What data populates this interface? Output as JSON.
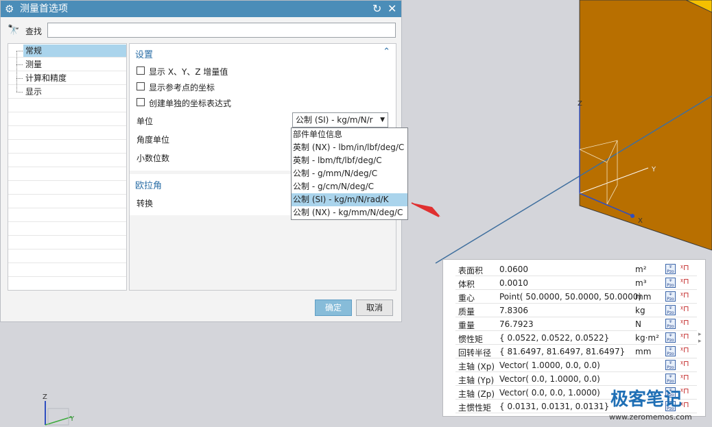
{
  "dialog": {
    "title": "测量首选项",
    "find_label": "查找",
    "find_value": "",
    "tree": [
      "常规",
      "测量",
      "计算和精度",
      "显示"
    ],
    "section1_title": "设置",
    "checkboxes": [
      "显示 X、Y、Z 增量值",
      "显示参考点的坐标",
      "创建单独的坐标表达式"
    ],
    "unit_label": "单位",
    "unit_value": "公制 (SI) - kg/m/N/r",
    "angle_unit_label": "角度单位",
    "decimals_label": "小数位数",
    "section2_title": "欧拉角",
    "convert_label": "转换",
    "ok_label": "确定",
    "cancel_label": "取消"
  },
  "dropdown": {
    "options": [
      "部件单位信息",
      "英制 (NX) - lbm/in/lbf/deg/C",
      "英制 - lbm/ft/lbf/deg/C",
      "公制 - g/mm/N/deg/C",
      "公制 - g/cm/N/deg/C",
      "公制 (SI) - kg/m/N/rad/K",
      "公制 (NX) - kg/mm/N/deg/C"
    ],
    "selected": "公制 (SI) - kg/m/N/rad/K"
  },
  "results": [
    {
      "name": "表面积",
      "value": "0.0600",
      "unit": "m²"
    },
    {
      "name": "体积",
      "value": "0.0010",
      "unit": "m³"
    },
    {
      "name": "重心",
      "value": "Point( 50.0000, 50.0000, 50.0000)",
      "unit": "mm"
    },
    {
      "name": "质量",
      "value": "7.8306",
      "unit": "kg"
    },
    {
      "name": "重量",
      "value": "76.7923",
      "unit": "N"
    },
    {
      "name": "惯性矩",
      "value": "{ 0.0522, 0.0522, 0.0522}",
      "unit": "kg·m²"
    },
    {
      "name": "回转半径",
      "value": "{ 81.6497, 81.6497, 81.6497}",
      "unit": "mm"
    },
    {
      "name": "主轴 (Xp)",
      "value": "Vector( 1.0000, 0.0, 0.0)",
      "unit": ""
    },
    {
      "name": "主轴 (Yp)",
      "value": "Vector( 0.0, 1.0000, 0.0)",
      "unit": ""
    },
    {
      "name": "主轴 (Zp)",
      "value": "Vector( 0.0, 0.0, 1.0000)",
      "unit": ""
    },
    {
      "name": "主惯性矩",
      "value": "{ 0.0131, 0.0131, 0.0131}",
      "unit": ""
    }
  ],
  "viewport": {
    "axis_labels": [
      "Z",
      "Y",
      "X"
    ],
    "triad_labels": [
      "Z",
      "Y"
    ]
  },
  "watermark": {
    "title": "极客笔记",
    "url": "www.zeromemos.com"
  },
  "colors": {
    "titlebar": "#4b8db8",
    "solid_face": "#b86f00",
    "solid_top": "#f5c000",
    "selection": "#aad4ec"
  }
}
